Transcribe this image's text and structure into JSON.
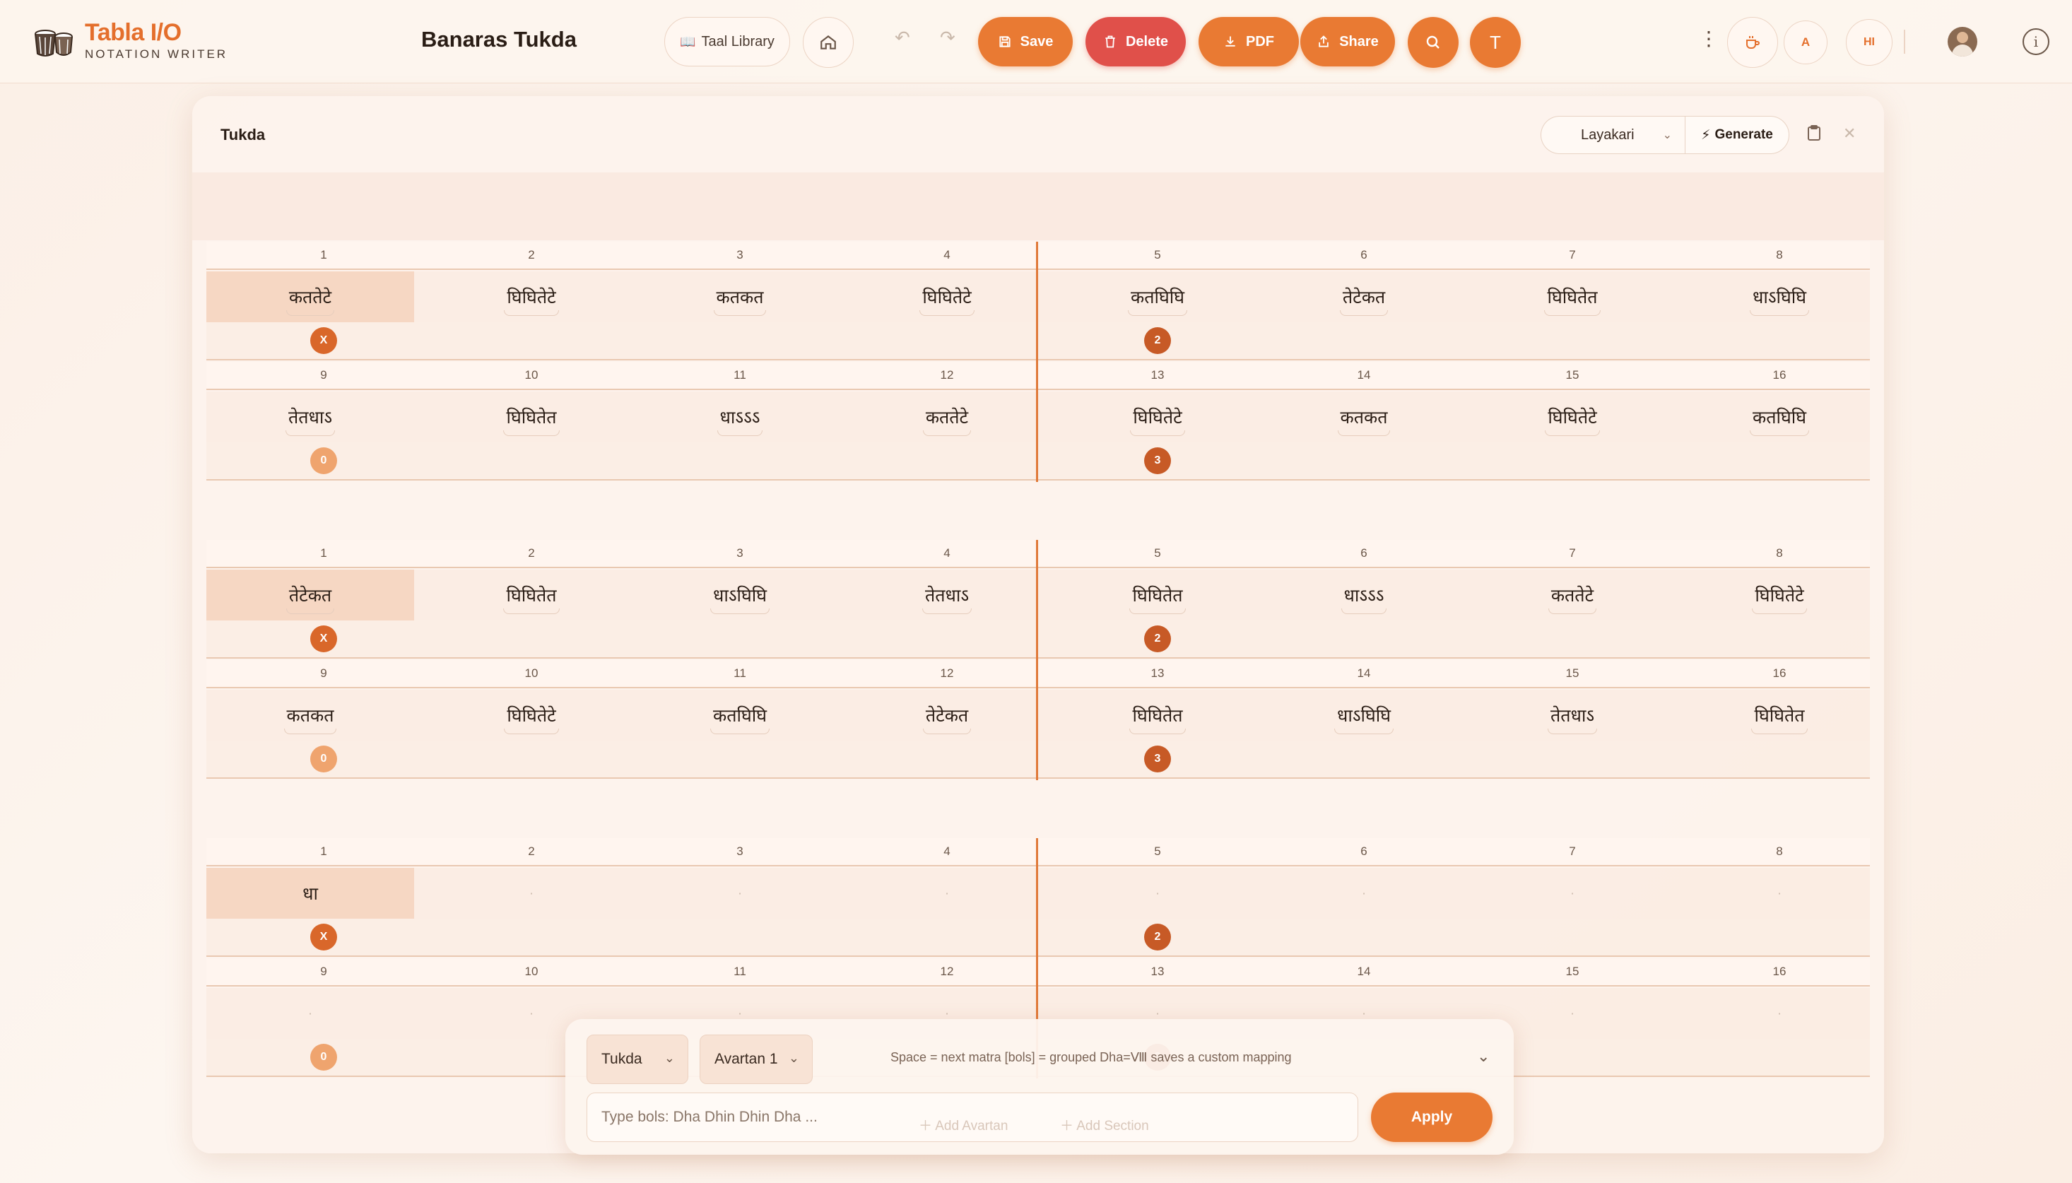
{
  "app": {
    "title": "Tabla I/O",
    "subtitle": "NOTATION WRITER"
  },
  "doc": {
    "title": "Banaras Tukda"
  },
  "toolbar": {
    "taal_library": "Taal Library",
    "save": "Save",
    "delete": "Delete",
    "pdf": "PDF",
    "share": "Share",
    "text_icon": "T",
    "lang_a": "A",
    "lang_hi": "HI"
  },
  "modal": {
    "title": "Tukda",
    "layakari": "Layakari",
    "generate": "Generate"
  },
  "matras": [
    "1",
    "2",
    "3",
    "4",
    "5",
    "6",
    "7",
    "8",
    "9",
    "10",
    "11",
    "12",
    "13",
    "14",
    "15",
    "16"
  ],
  "markers": {
    "m1": "X",
    "m5": "2",
    "m9": "0",
    "m13": "3"
  },
  "sections": [
    {
      "row1": [
        "कततेटे",
        "घिघितेटे",
        "कतकत",
        "घिघितेटे",
        "कतघिघि",
        "तेटेकत",
        "घिघितेत",
        "धाऽघिघि"
      ],
      "row2": [
        "तेतधाऽ",
        "घिघितेत",
        "धाऽऽऽ",
        "कततेटे",
        "घिघितेटे",
        "कतकत",
        "घिघितेटे",
        "कतघिघि"
      ]
    },
    {
      "row1": [
        "तेटेकत",
        "घिघितेत",
        "धाऽघिघि",
        "तेतधाऽ",
        "घिघितेत",
        "धाऽऽऽ",
        "कततेटे",
        "घिघितेटे"
      ],
      "row2": [
        "कतकत",
        "घिघितेटे",
        "कतघिघि",
        "तेटेकत",
        "घिघितेत",
        "धाऽघिघि",
        "तेतधाऽ",
        "घिघितेत"
      ]
    },
    {
      "row1": [
        "धा",
        "·",
        "·",
        "·",
        "·",
        "·",
        "·",
        "·"
      ],
      "row2": [
        "·",
        "·",
        "·",
        "·",
        "·",
        "·",
        "·",
        "·"
      ]
    }
  ],
  "panel": {
    "section_select": "Tukda",
    "avartan_select": "Avartan 1",
    "hint": "Space = next matra [bols] = grouped Dha=Ⅷ saves a custom mapping",
    "input_placeholder": "Type bols: Dha Dhin Dhin Dha ...",
    "apply": "Apply",
    "add_avartan": "Add Avartan",
    "add_section": "Add Section"
  }
}
